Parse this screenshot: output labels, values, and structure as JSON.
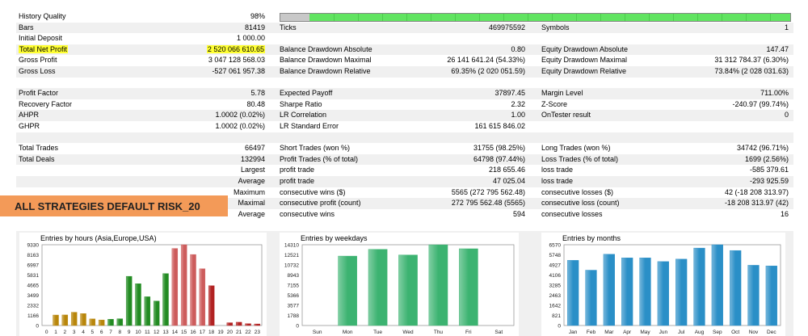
{
  "report": {
    "rows": [
      {
        "l1": "History Quality",
        "v1": "98%",
        "bar": true
      },
      {
        "l1": "Bars",
        "v1": "81419",
        "l2": "Ticks",
        "v2": "469975592",
        "l3": "Symbols",
        "v3": "1"
      },
      {
        "l1": "Initial Deposit",
        "v1": "1 000.00"
      },
      {
        "l1": "Total Net Profit",
        "v1": "2 520 066 610.65",
        "l2": "Balance Drawdown Absolute",
        "v2": "0.80",
        "l3": "Equity Drawdown Absolute",
        "v3": "147.47",
        "highlight": true
      },
      {
        "l1": "Gross Profit",
        "v1": "3 047 128 568.03",
        "l2": "Balance Drawdown Maximal",
        "v2": "26 141 641.24 (54.33%)",
        "l3": "Equity Drawdown Maximal",
        "v3": "31 312 784.37 (6.30%)"
      },
      {
        "l1": "Gross Loss",
        "v1": "-527 061 957.38",
        "l2": "Balance Drawdown Relative",
        "v2": "69.35% (2 020 051.59)",
        "l3": "Equity Drawdown Relative",
        "v3": "73.84% (2 028 031.63)"
      },
      {
        "empty": true
      },
      {
        "l1": "Profit Factor",
        "v1": "5.78",
        "l2": "Expected Payoff",
        "v2": "37897.45",
        "l3": "Margin Level",
        "v3": "711.00%"
      },
      {
        "l1": "Recovery Factor",
        "v1": "80.48",
        "l2": "Sharpe Ratio",
        "v2": "2.32",
        "l3": "Z-Score",
        "v3": "-240.97 (99.74%)"
      },
      {
        "l1": "AHPR",
        "v1": "1.0002 (0.02%)",
        "l2": "LR Correlation",
        "v2": "1.00",
        "l3": "OnTester result",
        "v3": "0"
      },
      {
        "l1": "GHPR",
        "v1": "1.0002 (0.02%)",
        "l2": "LR Standard Error",
        "v2": "161 615 846.02"
      },
      {
        "empty": true
      },
      {
        "l1": "Total Trades",
        "v1": "66497",
        "l2": "Short Trades (won %)",
        "v2": "31755 (98.25%)",
        "l3": "Long Trades (won %)",
        "v3": "34742 (96.71%)"
      },
      {
        "l1": "Total Deals",
        "v1": "132994",
        "l2": "Profit Trades (% of total)",
        "v2": "64798 (97.44%)",
        "l3": "Loss Trades (% of total)",
        "v3": "1699 (2.56%)"
      },
      {
        "v1": "Largest",
        "l2": "profit trade",
        "v2": "218 655.46",
        "l3": "loss trade",
        "v3": "-585 379.61"
      },
      {
        "v1": "Average",
        "l2": "profit trade",
        "v2": "47 025.04",
        "l3": "loss trade",
        "v3": "-293 925.59"
      },
      {
        "v1": "Maximum",
        "l2": "consecutive wins ($)",
        "v2": "5565 (272 795 562.48)",
        "l3": "consecutive losses ($)",
        "v3": "42 (-18 208 313.97)"
      },
      {
        "v1": "Maximal",
        "l2": "consecutive profit (count)",
        "v2": "272 795 562.48 (5565)",
        "l3": "consecutive loss (count)",
        "v3": "-18 208 313.97 (42)"
      },
      {
        "v1": "Average",
        "l2": "consecutive wins",
        "v2": "594",
        "l3": "consecutive losses",
        "v3": "16"
      }
    ]
  },
  "banner": {
    "text": "ALL STRATEGIES DEFAULT RISK_20",
    "color": "#f39a58"
  },
  "colors": {
    "highlight": "#ffff33",
    "quality_bar": "#61e461",
    "gray": "#c8c8c8"
  },
  "chart_data": [
    {
      "type": "bar",
      "title": "Entries by hours (Asia,Europe,USA)",
      "categories": [
        "0",
        "1",
        "2",
        "3",
        "4",
        "5",
        "6",
        "7",
        "8",
        "9",
        "10",
        "11",
        "12",
        "13",
        "14",
        "15",
        "16",
        "17",
        "18",
        "19",
        "20",
        "21",
        "22",
        "23"
      ],
      "values": [
        0,
        1210,
        1220,
        1530,
        1380,
        760,
        640,
        720,
        780,
        5680,
        4830,
        3320,
        2820,
        6000,
        8900,
        9330,
        8200,
        6550,
        4600,
        0,
        320,
        380,
        210,
        180
      ],
      "colors": [
        "#b8860b",
        "#b8860b",
        "#b8860b",
        "#b8860b",
        "#b8860b",
        "#b8860b",
        "#b8860b",
        "#228b22",
        "#228b22",
        "#228b22",
        "#228b22",
        "#228b22",
        "#228b22",
        "#228b22",
        "#cd5c5c",
        "#cd5c5c",
        "#cd5c5c",
        "#cd5c5c",
        "#b22222",
        "#b22222",
        "#b22222",
        "#b22222",
        "#b22222",
        "#b22222"
      ],
      "yticks": [
        "9330",
        "8163",
        "6997",
        "5831",
        "4665",
        "3499",
        "2332",
        "1166",
        "0"
      ],
      "ylim": [
        0,
        9330
      ]
    },
    {
      "type": "bar",
      "title": "Entries by weekdays",
      "categories": [
        "Sun",
        "Mon",
        "Tue",
        "Wed",
        "Thu",
        "Fri",
        "Sat"
      ],
      "values": [
        0,
        12300,
        13500,
        12500,
        14300,
        13600,
        0
      ],
      "colors": [
        "#3cb371",
        "#3cb371",
        "#3cb371",
        "#3cb371",
        "#3cb371",
        "#3cb371",
        "#3cb371"
      ],
      "yticks": [
        "14310",
        "12521",
        "10732",
        "8943",
        "7155",
        "5366",
        "3577",
        "1788",
        "0"
      ],
      "ylim": [
        0,
        14310
      ]
    },
    {
      "type": "bar",
      "title": "Entries by months",
      "categories": [
        "Jan",
        "Feb",
        "Mar",
        "Apr",
        "May",
        "Jun",
        "Jul",
        "Aug",
        "Sep",
        "Oct",
        "Nov",
        "Dec"
      ],
      "values": [
        5300,
        4500,
        5800,
        5500,
        5500,
        5200,
        5400,
        6300,
        6570,
        6100,
        4900,
        4850
      ],
      "colors": [
        "#2a8fc7",
        "#2a8fc7",
        "#2a8fc7",
        "#2a8fc7",
        "#2a8fc7",
        "#2a8fc7",
        "#2a8fc7",
        "#2a8fc7",
        "#2a8fc7",
        "#2a8fc7",
        "#2a8fc7",
        "#2a8fc7"
      ],
      "yticks": [
        "6570",
        "5748",
        "4927",
        "4106",
        "3285",
        "2463",
        "1642",
        "821",
        "0"
      ],
      "ylim": [
        0,
        6570
      ]
    }
  ]
}
